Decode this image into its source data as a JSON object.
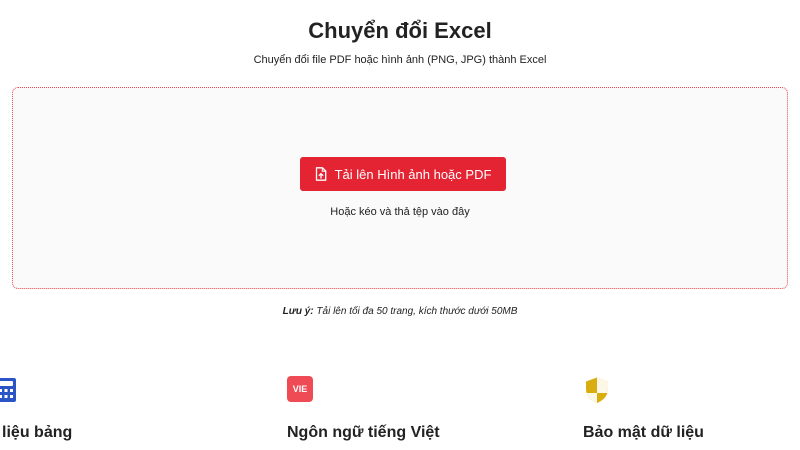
{
  "header": {
    "title": "Chuyển đổi Excel",
    "subtitle": "Chuyển đổi file PDF hoặc hình ảnh (PNG, JPG) thành Excel"
  },
  "dropzone": {
    "upload_button_label": "Tải lên Hình ảnh hoặc PDF",
    "upload_icon": "file-upload-icon",
    "drag_hint": "Hoặc kéo và thả tệp vào đây"
  },
  "note": {
    "label": "Lưu ý:",
    "text": "Tải lên tối đa 50 trang, kích thước dưới 50MB"
  },
  "features": [
    {
      "icon": "table-calculator-icon",
      "label": "ữ liệu bảng"
    },
    {
      "icon": "vie-badge-icon",
      "badge_text": "VIE",
      "label": "Ngôn ngữ tiếng Việt"
    },
    {
      "icon": "shield-icon",
      "label": "Bảo mật dữ liệu"
    }
  ],
  "colors": {
    "accent": "#e52433",
    "dropzone_border": "#e8474b",
    "table_icon": "#2b55c7",
    "vie_badge": "#ee4b55",
    "shield": "#d9ad0f"
  }
}
